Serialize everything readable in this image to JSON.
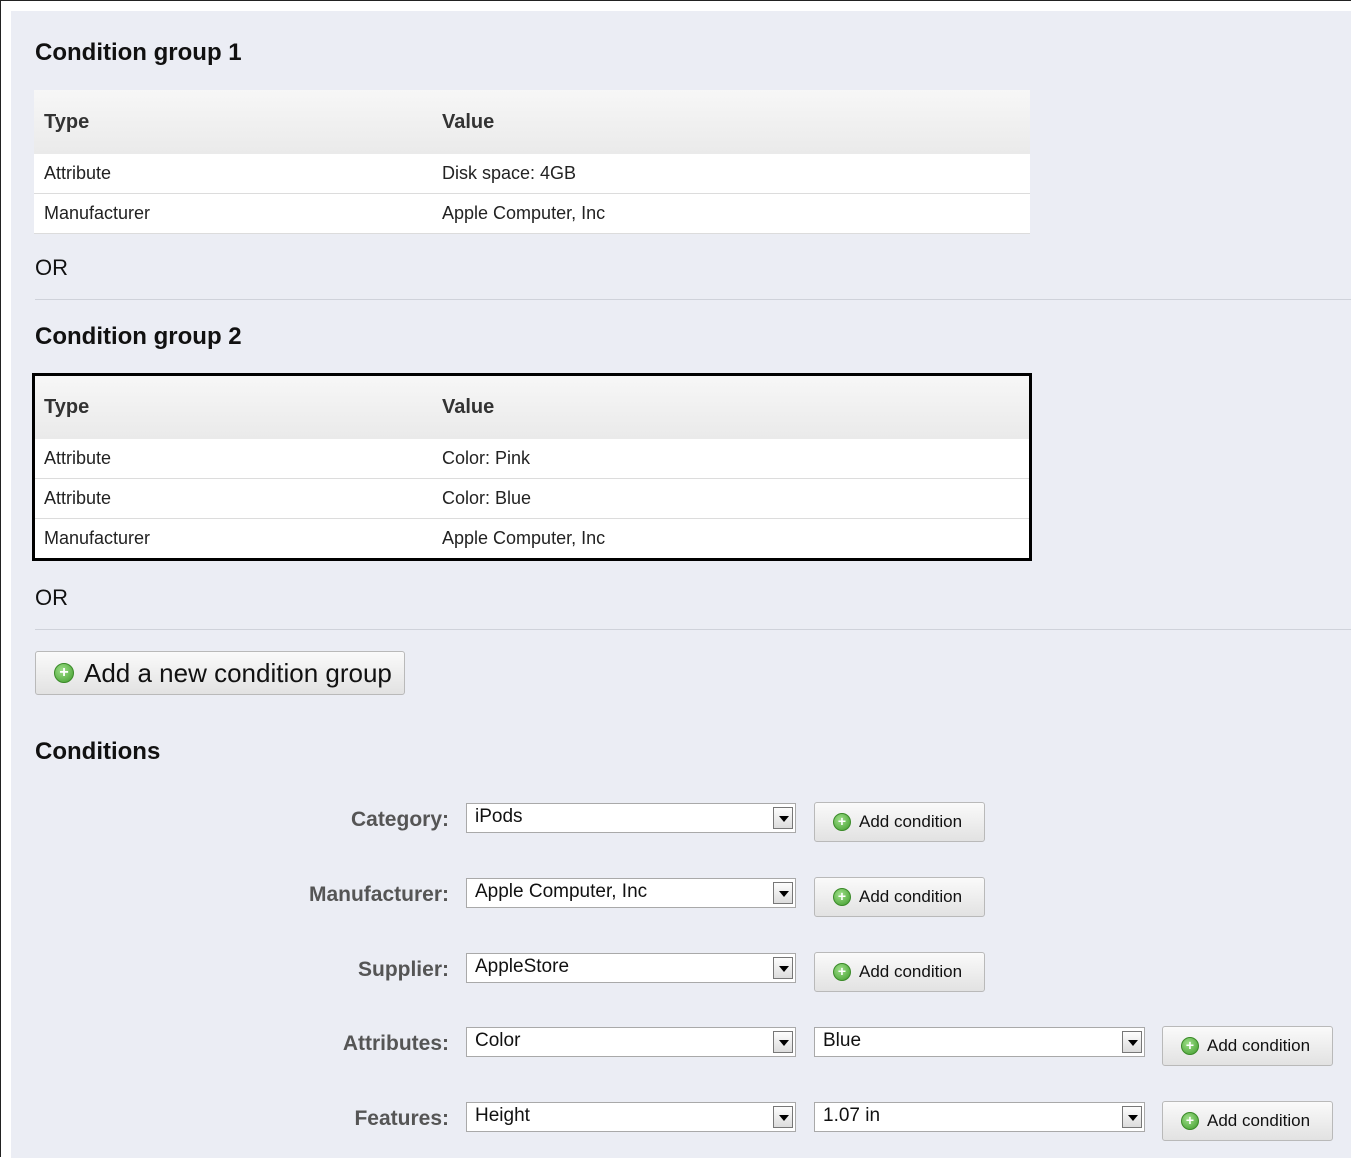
{
  "groups": [
    {
      "title": "Condition group 1",
      "headers": {
        "type": "Type",
        "value": "Value"
      },
      "rows": [
        {
          "type": "Attribute",
          "value": "Disk space: 4GB"
        },
        {
          "type": "Manufacturer",
          "value": "Apple Computer, Inc"
        }
      ],
      "separator": "OR"
    },
    {
      "title": "Condition group 2",
      "headers": {
        "type": "Type",
        "value": "Value"
      },
      "rows": [
        {
          "type": "Attribute",
          "value": "Color: Pink"
        },
        {
          "type": "Attribute",
          "value": "Color: Blue"
        },
        {
          "type": "Manufacturer",
          "value": "Apple Computer, Inc"
        }
      ],
      "separator": "OR"
    }
  ],
  "add_group_button": {
    "label": "Add a new condition group",
    "icon": "plus-circle-icon"
  },
  "conditions": {
    "title": "Conditions",
    "rows": [
      {
        "label": "Category:",
        "select1": "iPods",
        "button": "Add condition"
      },
      {
        "label": "Manufacturer:",
        "select1": "Apple Computer, Inc",
        "button": "Add condition"
      },
      {
        "label": "Supplier:",
        "select1": "AppleStore",
        "button": "Add condition"
      },
      {
        "label": "Attributes:",
        "select1": "Color",
        "select2": "Blue",
        "button": "Add condition"
      },
      {
        "label": "Features:",
        "select1": "Height",
        "select2": "1.07 in",
        "button": "Add condition"
      }
    ]
  },
  "colors": {
    "panel_background": "#ebedf4",
    "button_plus": "#3e9a2a",
    "label_text": "#555555"
  }
}
